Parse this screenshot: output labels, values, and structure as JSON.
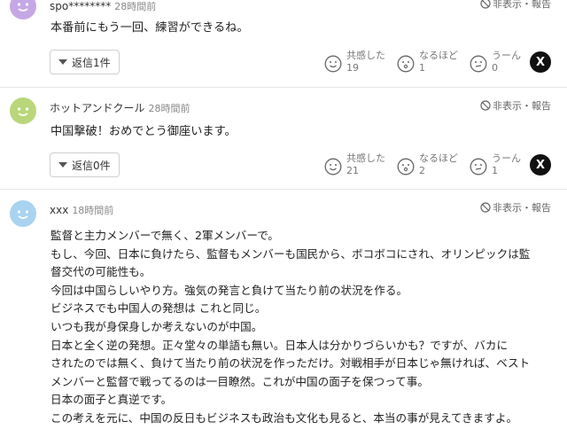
{
  "comments": [
    {
      "user": "spo********",
      "time": "28時間前",
      "hide_label": "非表示・報告",
      "body_lines": [
        "本番前にもう一回、練習ができるね。"
      ],
      "reply_label": "返信1件",
      "reactions": [
        {
          "label": "共感した",
          "count": "19"
        },
        {
          "label": "なるほど",
          "count": "1"
        },
        {
          "label": "うーん",
          "count": "0"
        }
      ],
      "avatar_color": "#c6a7e6"
    },
    {
      "user": "ホットアンドクール",
      "time": "28時間前",
      "hide_label": "非表示・報告",
      "body_lines": [
        "中国撃破！おめでとう御座います。"
      ],
      "reply_label": "返信0件",
      "reactions": [
        {
          "label": "共感した",
          "count": "21"
        },
        {
          "label": "なるほど",
          "count": "2"
        },
        {
          "label": "うーん",
          "count": "1"
        }
      ],
      "avatar_color": "#b9d77a"
    },
    {
      "user": "xxx",
      "time": "18時間前",
      "hide_label": "非表示・報告",
      "body_lines": [
        "監督と主力メンバーで無く、2軍メンバーで。",
        "もし、今回、日本に負けたら、監督もメンバーも国民から、ボコボコにされ、オリンピックは監",
        "督交代の可能性も。",
        "今回は中国らしいやり方。強気の発言と負けて当たり前の状況を作る。",
        "ビジネスでも中国人の発想は これと同じ。",
        "いつも我が身保身しか考えないのが中国。",
        "日本と全く逆の発想。正々堂々の単語も無い。日本人は分かりづらいかも？ですが、バカに",
        "されたのでは無く、負けて当たり前の状況を作っただけ。対戦相手が日本じゃ無ければ、ベスト",
        "メンバーと監督で戦ってるのは一目瞭然。これが中国の面子を保つって事。",
        "日本の面子と真逆です。",
        "この考えを元に、中国の反日もビジネスも政治も文化も見ると、本当の事が見えてきますよ。"
      ],
      "avatar_color": "#a9d3f0"
    }
  ],
  "icons": {
    "hide": "hide-icon",
    "empathy": "smile-face-icon",
    "naruhodo": "surprised-face-icon",
    "uun": "thinking-face-icon",
    "share": "x-logo-icon"
  },
  "share_label": "X"
}
